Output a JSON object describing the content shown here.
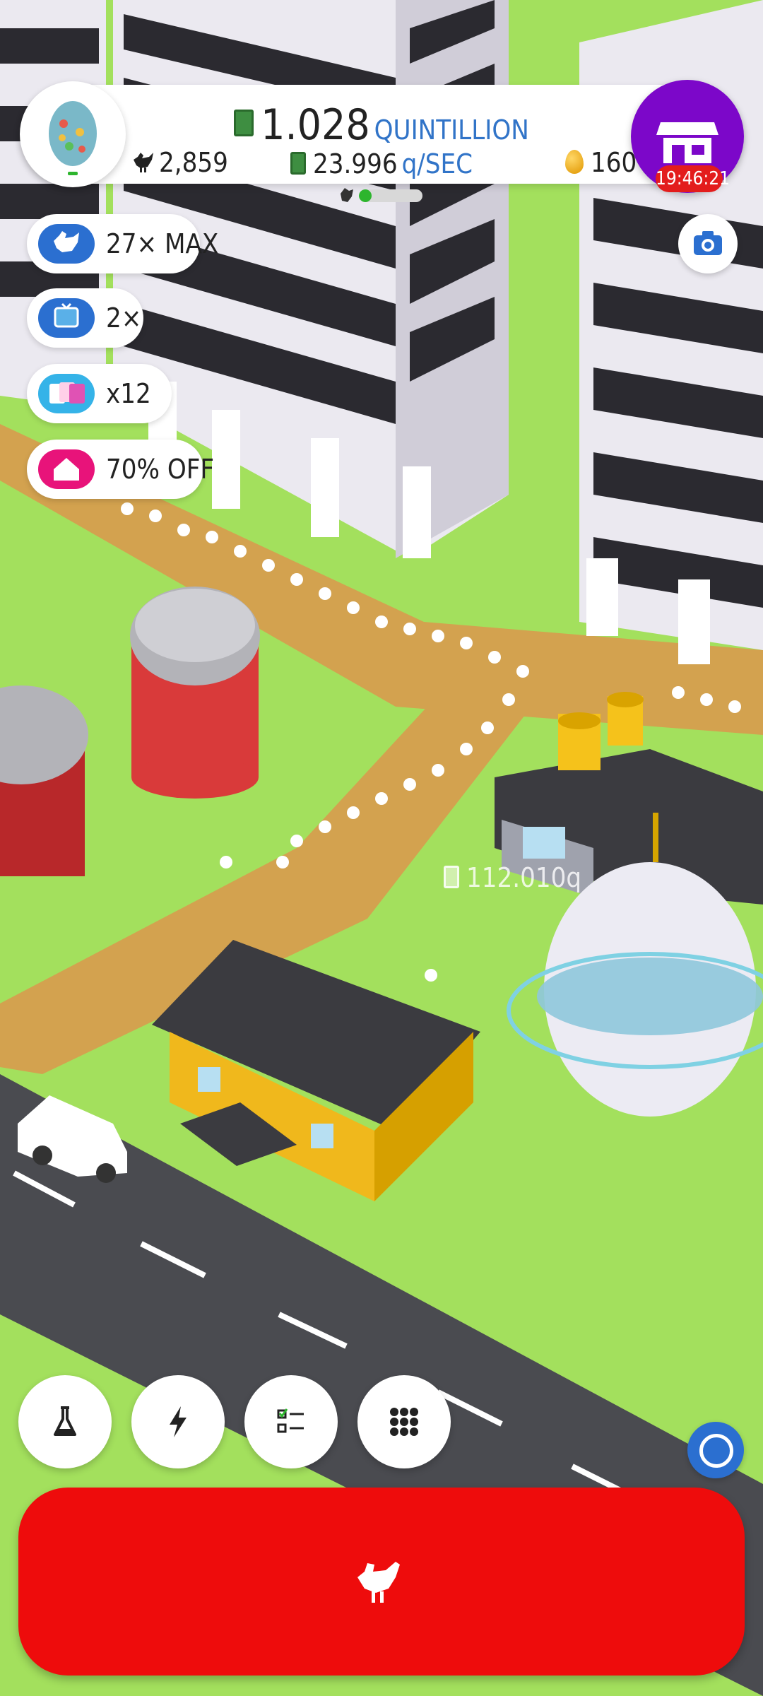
{
  "top_bar": {
    "money_value": "1.028",
    "money_unit": "QUINTILLION",
    "rate_value": "23.996",
    "rate_unit": "q/SEC",
    "chicken_count": "2,859",
    "golden_eggs": "160",
    "shipping_progress": 0.2,
    "shop_timer": "19:46:21"
  },
  "boosts": [
    {
      "icon": "chicken-icon",
      "label": "27× MAX",
      "color": "#2b6fd0"
    },
    {
      "icon": "tv-icon",
      "label": "2×",
      "color": "#2b6fd0"
    },
    {
      "icon": "boost-cards-icon",
      "label": "x12",
      "color": "#35b3e8"
    },
    {
      "icon": "house-icon",
      "label": "70% OFF",
      "color": "#e8137a"
    }
  ],
  "floating_income": "112.010q",
  "bottom_buttons": [
    {
      "icon": "research-flask-icon"
    },
    {
      "icon": "boost-lightning-icon"
    },
    {
      "icon": "missions-checklist-icon"
    },
    {
      "icon": "menu-grid-icon"
    }
  ],
  "colors": {
    "grass": "#a3e05d",
    "road": "#4a4a4f",
    "hatch_button": "#ee0c0c",
    "shop_button": "#7c07c9",
    "accent_blue": "#3174c8"
  }
}
